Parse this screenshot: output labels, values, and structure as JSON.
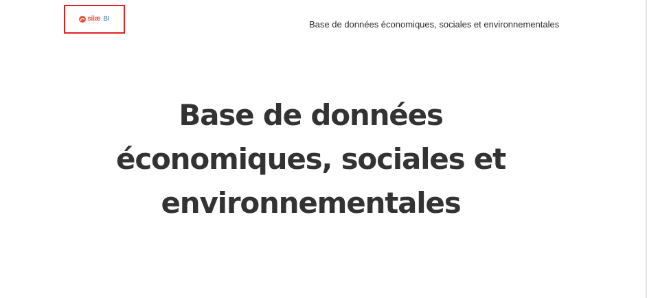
{
  "header": {
    "logo": {
      "text": "silæ",
      "suffix": "BI",
      "brand_color": "#e8533a",
      "suffix_color": "#3a6ea5",
      "highlight_border_color": "#e02020"
    },
    "title": "Base de données économiques, sociales et environnementales"
  },
  "hero": {
    "title": "Base de données économiques, sociales et environnementales"
  }
}
